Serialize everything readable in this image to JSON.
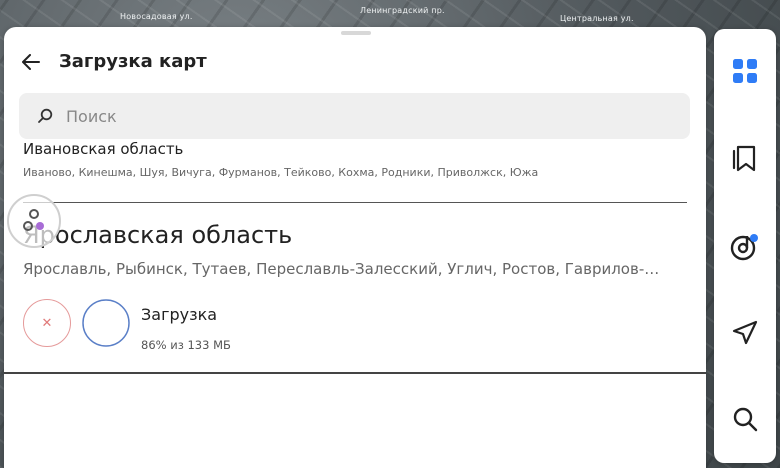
{
  "colors": {
    "accent": "#2f7cf6",
    "cancel": "#e07a7a",
    "ring": "#5a7fc7"
  },
  "map": {
    "labels": [
      "Новосадовая ул.",
      "Ленинградский пр.",
      "Центральная ул."
    ]
  },
  "header": {
    "title": "Загрузка карт",
    "back_icon": "arrow-left-icon"
  },
  "search": {
    "placeholder": "Поиск",
    "value": "",
    "icon": "search-icon"
  },
  "regions": [
    {
      "name": "Ивановская область",
      "cities": "Иваново, Кинешма, Шуя, Вичуга, Фурманов, Тейково, Кохма, Родники, Приволжск, Южа"
    },
    {
      "name": "Ярославская область",
      "cities": "Ярославль, Рыбинск, Тутаев, Переславль-Залесский, Углич, Ростов, Гаврилов-…"
    }
  ],
  "download": {
    "title": "Загрузка",
    "progress_percent": 86,
    "status": "86% из 133 МБ",
    "cancel_icon": "close-icon"
  },
  "sidebar": {
    "items": [
      "grid-icon",
      "bookmarks-icon",
      "music-icon",
      "navigation-icon",
      "search-icon"
    ]
  }
}
